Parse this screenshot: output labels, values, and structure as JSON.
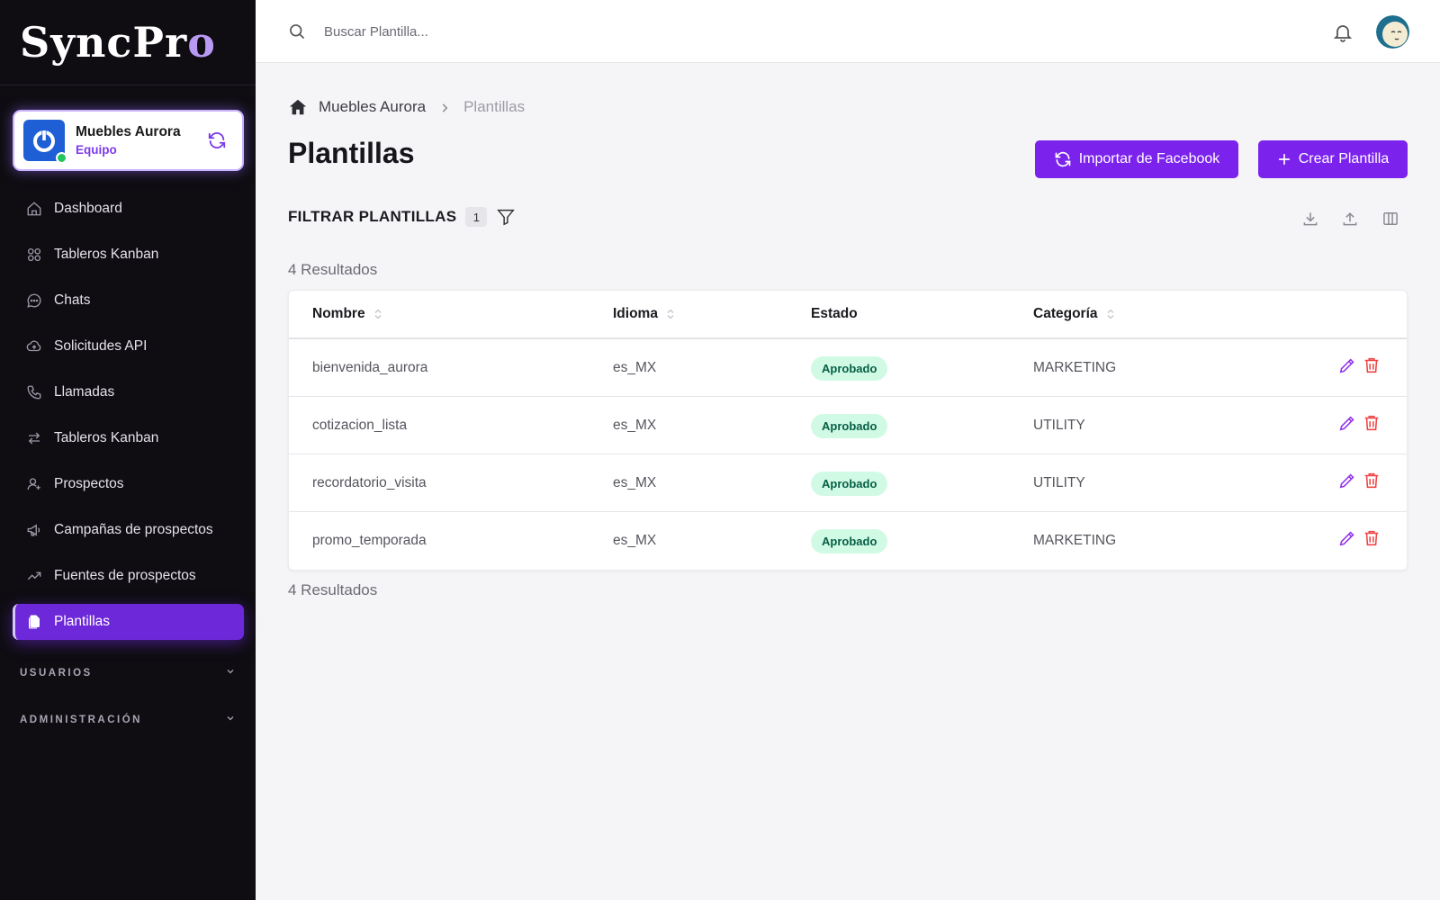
{
  "app": {
    "logo_main": "SyncPr",
    "logo_accent": "o"
  },
  "team": {
    "name": "Muebles Aurora",
    "role": "Equipo"
  },
  "sidebar": {
    "items": [
      {
        "label": "Dashboard",
        "icon": "home-icon"
      },
      {
        "label": "Tableros Kanban",
        "icon": "grid-icon"
      },
      {
        "label": "Chats",
        "icon": "chat-icon"
      },
      {
        "label": "Solicitudes API",
        "icon": "cloud-upload-icon"
      },
      {
        "label": "Llamadas",
        "icon": "phone-icon"
      },
      {
        "label": "Tableros Kanban",
        "icon": "arrows-icon"
      },
      {
        "label": "Prospectos",
        "icon": "user-add-icon"
      },
      {
        "label": "Campañas de prospectos",
        "icon": "megaphone-icon"
      },
      {
        "label": "Fuentes de prospectos",
        "icon": "trend-icon"
      },
      {
        "label": "Plantillas",
        "icon": "documents-icon",
        "active": true
      }
    ],
    "sections": [
      {
        "label": "USUARIOS"
      },
      {
        "label": "ADMINISTRACIÓN"
      }
    ]
  },
  "search": {
    "placeholder": "Buscar Plantilla..."
  },
  "breadcrumb": {
    "parent": "Muebles Aurora",
    "current": "Plantillas"
  },
  "page": {
    "title": "Plantillas",
    "import_label": "Importar de Facebook",
    "create_label": "Crear Plantilla"
  },
  "filter": {
    "title": "FILTRAR PLANTILLAS",
    "count": "1"
  },
  "results": {
    "top": "4 Resultados",
    "bottom": "4 Resultados"
  },
  "table": {
    "columns": [
      "Nombre",
      "Idioma",
      "Estado",
      "Categoría"
    ],
    "rows": [
      {
        "name": "bienvenida_aurora",
        "lang": "es_MX",
        "status": "Aprobado",
        "category": "MARKETING"
      },
      {
        "name": "cotizacion_lista",
        "lang": "es_MX",
        "status": "Aprobado",
        "category": "UTILITY"
      },
      {
        "name": "recordatorio_visita",
        "lang": "es_MX",
        "status": "Aprobado",
        "category": "UTILITY"
      },
      {
        "name": "promo_temporada",
        "lang": "es_MX",
        "status": "Aprobado",
        "category": "MARKETING"
      }
    ]
  },
  "colors": {
    "accent": "#7c22ed",
    "sidebar_bg": "#0f0d12",
    "badge_bg": "#d1fae5",
    "badge_text": "#065f46",
    "delete": "#ef4444"
  }
}
